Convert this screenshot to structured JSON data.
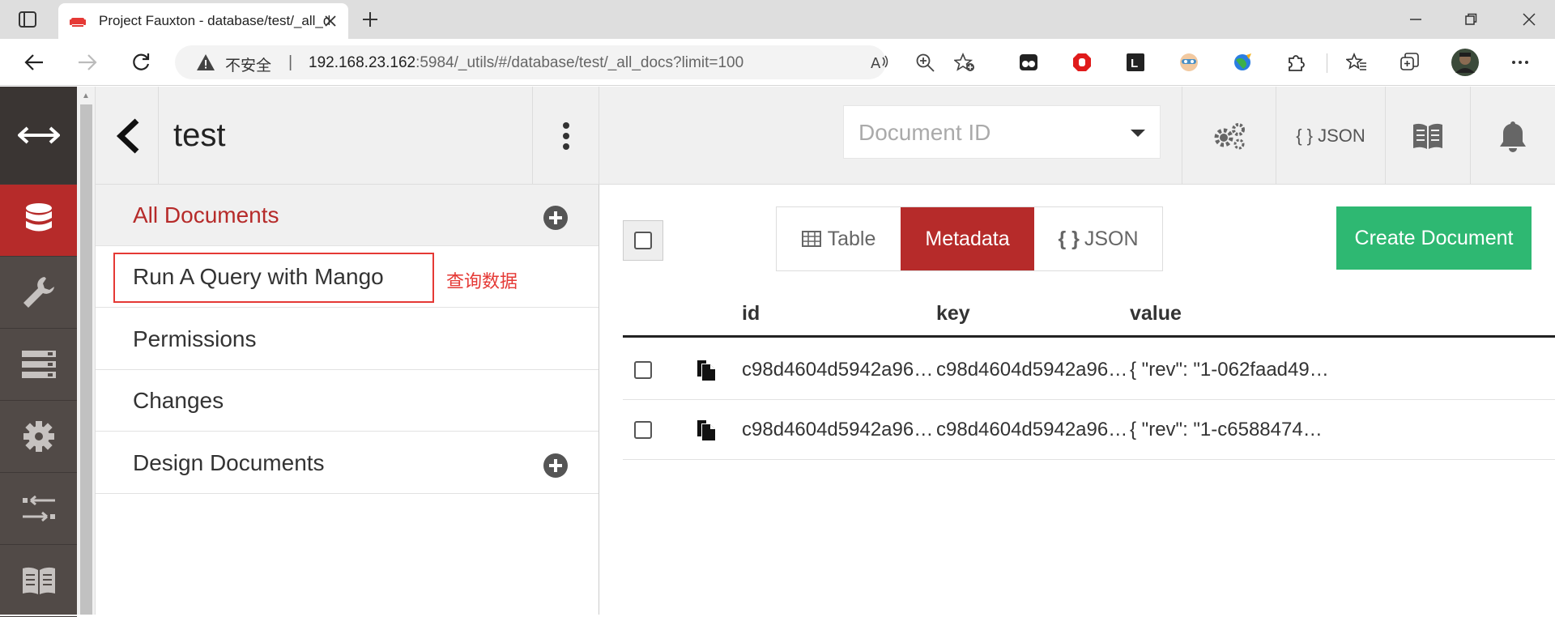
{
  "browser": {
    "tab_title": "Project Fauxton - database/test/_all_docs",
    "security_label": "不安全",
    "url_host": "192.168.23.162",
    "url_rest": ":5984/_utils/#/database/test/_all_docs?limit=100"
  },
  "fauxton": {
    "db_name": "test",
    "doc_id_placeholder": "Document ID",
    "json_button": "{ } JSON",
    "sidebar": [
      {
        "label": "All Documents"
      },
      {
        "label": "Run A Query with Mango"
      },
      {
        "label": "Permissions"
      },
      {
        "label": "Changes"
      },
      {
        "label": "Design Documents"
      }
    ],
    "annotation": "查询数据",
    "view_tabs": {
      "table": "Table",
      "metadata": "Metadata",
      "json": "JSON"
    },
    "create_button": "Create Document",
    "columns": {
      "id": "id",
      "key": "key",
      "value": "value"
    },
    "rows": [
      {
        "id": "c98d4604d5942a96…",
        "key": "c98d4604d5942a96…",
        "value": "{ \"rev\": \"1-062faad49…"
      },
      {
        "id": "c98d4604d5942a96…",
        "key": "c98d4604d5942a96…",
        "value": "{ \"rev\": \"1-c6588474…"
      }
    ]
  },
  "colors": {
    "accent": "#b62b2a",
    "create": "#2eb872",
    "nav_bg": "#514a47",
    "annotation": "#e53935"
  }
}
